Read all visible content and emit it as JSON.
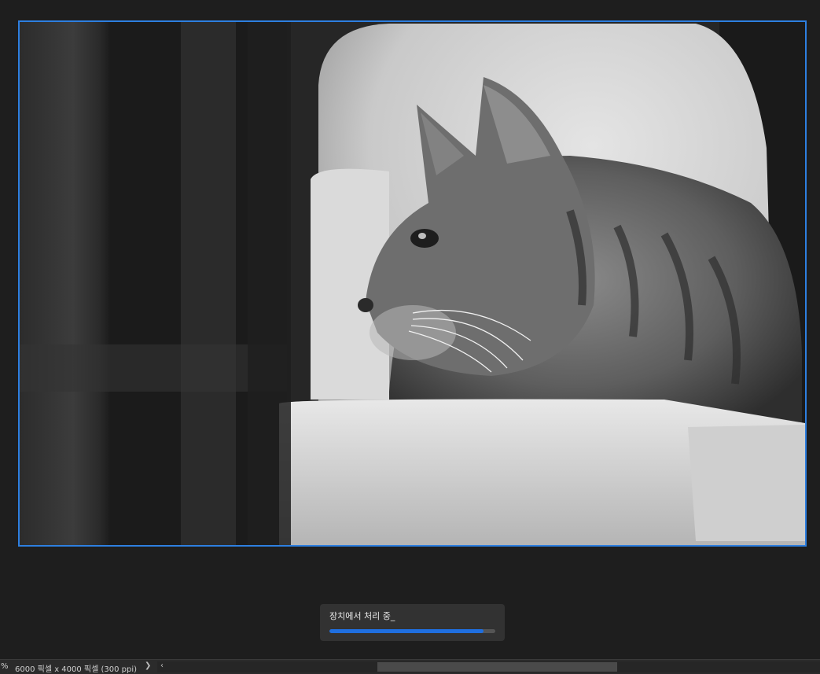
{
  "document": {
    "image_description_icon": "grayscale-cat-photo"
  },
  "toast": {
    "message": "장치에서 처리 중_",
    "progress": 0.93,
    "accent_color": "#1f6fe0"
  },
  "statusbar": {
    "zoom_suffix": "%",
    "document_info": "6000 픽셀 x 4000 픽셀 (300 ppi)",
    "next_arrow": "❯",
    "prev_arrow": "‹"
  },
  "colors": {
    "selection_border": "#2d7fe0",
    "background": "#1e1e1e"
  }
}
